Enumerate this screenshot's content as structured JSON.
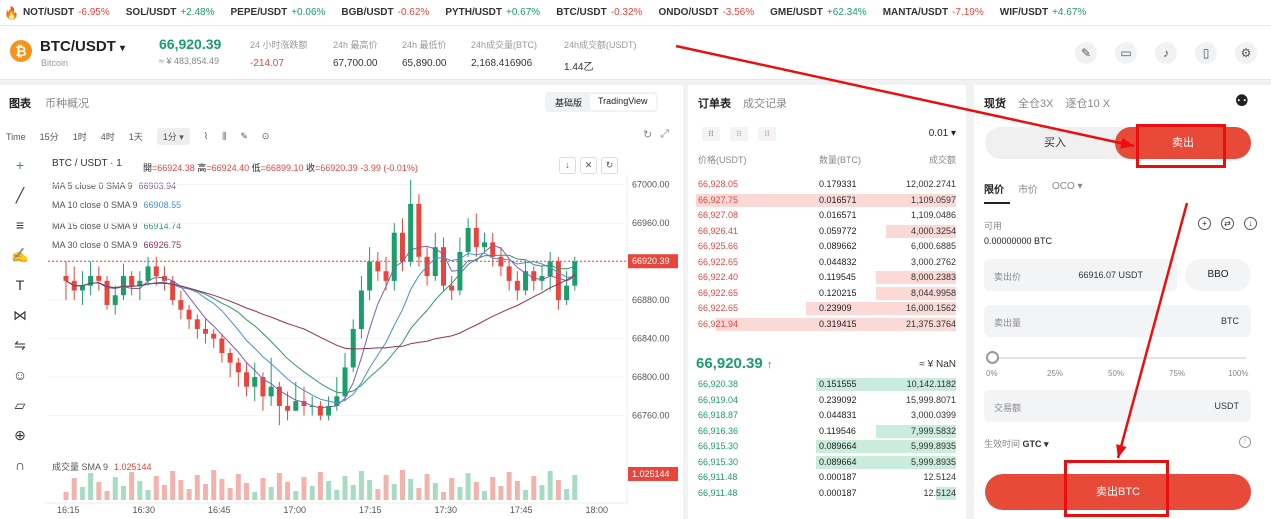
{
  "ticker": [
    {
      "sym": "NOT/USDT",
      "chg": "-6.95%",
      "dir": "dn"
    },
    {
      "sym": "SOL/USDT",
      "chg": "+2.48%",
      "dir": "up"
    },
    {
      "sym": "PEPE/USDT",
      "chg": "+0.06%",
      "dir": "up"
    },
    {
      "sym": "BGB/USDT",
      "chg": "-0.62%",
      "dir": "dn"
    },
    {
      "sym": "PYTH/USDT",
      "chg": "+0.67%",
      "dir": "up"
    },
    {
      "sym": "BTC/USDT",
      "chg": "-0.32%",
      "dir": "dn"
    },
    {
      "sym": "ONDO/USDT",
      "chg": "-3.56%",
      "dir": "dn"
    },
    {
      "sym": "GME/USDT",
      "chg": "+62.34%",
      "dir": "up"
    },
    {
      "sym": "MANTA/USDT",
      "chg": "-7.19%",
      "dir": "dn"
    },
    {
      "sym": "WIF/USDT",
      "chg": "+4.67%",
      "dir": "up"
    }
  ],
  "header": {
    "pair": "BTC/USDT",
    "caret": "▾",
    "sub": "Bitcoin",
    "logo": "₿",
    "price": "66,920.39",
    "price_cny": "≈ ¥ 483,854.49",
    "stats": [
      {
        "label": "24 小时涨跌额",
        "value": "-214.07",
        "color": "#e8453c"
      },
      {
        "label": "24h 最高价",
        "value": "67,700.00",
        "color": "#333"
      },
      {
        "label": "24h 最低价",
        "value": "65,890.00",
        "color": "#333"
      },
      {
        "label": "24h成交量(BTC)",
        "value": "2,168.416906",
        "color": "#333"
      },
      {
        "label": "24h成交额(USDT)",
        "value": "1.44乙",
        "color": "#333"
      }
    ],
    "icons": [
      "note-icon",
      "ticket-icon",
      "bell-icon",
      "book-icon",
      "settings-icon"
    ]
  },
  "chart_panel": {
    "tab_chart": "图表",
    "tab_overview": "币种概况",
    "view_basic": "基础版",
    "view_tv": "TradingView",
    "intervals": [
      "Time",
      "15分",
      "1时",
      "4时",
      "1天"
    ],
    "interval_selected": "1分 ▾",
    "caption": "BTC / USDT · 1",
    "ohlc": {
      "open_label": "開",
      "open": "=66924.38",
      "high_label": "高",
      "high": "=66924.40",
      "low_label": "低",
      "low": "=66899.10",
      "close_label": "收",
      "close": "=66920.39",
      "change": "-3.99 (-0.01%)"
    },
    "ma": [
      {
        "label": "MA 5 close 0 SMA 9",
        "value": "66903.94",
        "color": "#7b5fb1"
      },
      {
        "label": "MA 10 close 0 SMA 9",
        "value": "66908.55",
        "color": "#4a8fd8"
      },
      {
        "label": "MA 15 close 0 SMA 9",
        "value": "66914.74",
        "color": "#2e9a6a"
      },
      {
        "label": "MA 30 close 0 SMA 9",
        "value": "66926.75",
        "color": "#9b2d5a"
      }
    ],
    "volume_label": "成交量 SMA 9",
    "volume_value": "1.025144",
    "volume_tag": "1.025144",
    "last_price_tag": "66920.39"
  },
  "chart_data": {
    "type": "candlestick",
    "y_ticks": [
      67000,
      66960,
      66920,
      66880,
      66840,
      66800,
      66760
    ],
    "x_ticks": [
      "16:15",
      "16:30",
      "16:45",
      "17:00",
      "17:15",
      "17:30",
      "17:45",
      "18:00"
    ],
    "candles": [
      [
        66905,
        66900,
        66920,
        66880
      ],
      [
        66900,
        66890,
        66915,
        66880
      ],
      [
        66890,
        66895,
        66910,
        66875
      ],
      [
        66895,
        66905,
        66920,
        66885
      ],
      [
        66905,
        66900,
        66915,
        66890
      ],
      [
        66900,
        66875,
        66905,
        66870
      ],
      [
        66875,
        66885,
        66895,
        66865
      ],
      [
        66885,
        66905,
        66918,
        66880
      ],
      [
        66905,
        66895,
        66910,
        66885
      ],
      [
        66895,
        66900,
        66910,
        66880
      ],
      [
        66900,
        66915,
        66925,
        66895
      ],
      [
        66915,
        66905,
        66925,
        66895
      ],
      [
        66905,
        66900,
        66915,
        66890
      ],
      [
        66900,
        66880,
        66905,
        66875
      ],
      [
        66880,
        66870,
        66890,
        66860
      ],
      [
        66870,
        66860,
        66875,
        66850
      ],
      [
        66860,
        66850,
        66865,
        66840
      ],
      [
        66850,
        66845,
        66860,
        66835
      ],
      [
        66845,
        66840,
        66850,
        66830
      ],
      [
        66840,
        66825,
        66845,
        66815
      ],
      [
        66825,
        66815,
        66830,
        66800
      ],
      [
        66815,
        66805,
        66820,
        66790
      ],
      [
        66805,
        66790,
        66815,
        66780
      ],
      [
        66790,
        66800,
        66815,
        66775
      ],
      [
        66800,
        66780,
        66805,
        66765
      ],
      [
        66780,
        66790,
        66820,
        66770
      ],
      [
        66790,
        66770,
        66795,
        66750
      ],
      [
        66770,
        66765,
        66785,
        66755
      ],
      [
        66765,
        66775,
        66795,
        66765
      ],
      [
        66775,
        66770,
        66790,
        66760
      ],
      [
        66770,
        66770,
        66780,
        66760
      ],
      [
        66770,
        66760,
        66775,
        66755
      ],
      [
        66760,
        66770,
        66780,
        66755
      ],
      [
        66770,
        66780,
        66800,
        66765
      ],
      [
        66780,
        66810,
        66825,
        66775
      ],
      [
        66810,
        66850,
        66860,
        66805
      ],
      [
        66850,
        66890,
        66905,
        66840
      ],
      [
        66890,
        66920,
        66935,
        66880
      ],
      [
        66920,
        66910,
        66930,
        66900
      ],
      [
        66910,
        66900,
        66925,
        66890
      ],
      [
        66900,
        66950,
        66960,
        66890
      ],
      [
        66950,
        66920,
        66965,
        66910
      ],
      [
        66920,
        66980,
        67005,
        66915
      ],
      [
        66980,
        66925,
        66990,
        66915
      ],
      [
        66925,
        66905,
        66935,
        66895
      ],
      [
        66905,
        66935,
        66950,
        66900
      ],
      [
        66935,
        66895,
        66945,
        66890
      ],
      [
        66895,
        66890,
        66905,
        66880
      ],
      [
        66890,
        66930,
        66945,
        66885
      ],
      [
        66930,
        66955,
        66965,
        66925
      ],
      [
        66955,
        66935,
        66970,
        66925
      ],
      [
        66935,
        66940,
        66950,
        66930
      ],
      [
        66940,
        66925,
        66950,
        66915
      ],
      [
        66925,
        66915,
        66935,
        66905
      ],
      [
        66915,
        66900,
        66920,
        66890
      ],
      [
        66900,
        66890,
        66910,
        66880
      ],
      [
        66890,
        66910,
        66920,
        66885
      ],
      [
        66910,
        66900,
        66915,
        66890
      ],
      [
        66900,
        66905,
        66915,
        66890
      ],
      [
        66905,
        66920,
        66930,
        66890
      ],
      [
        66920,
        66880,
        66925,
        66870
      ],
      [
        66880,
        66895,
        66910,
        66875
      ],
      [
        66895,
        66920,
        66925,
        66890
      ]
    ],
    "ylim": [
      66745,
      67010
    ],
    "volume_max": 4
  },
  "orderbook": {
    "tab_book": "订单表",
    "tab_trades": "成交记录",
    "precision": "0.01 ▾",
    "headers": [
      "价格(USDT)",
      "数量(BTC)",
      "成交额"
    ],
    "asks": [
      {
        "p": "66,928.05",
        "a": "0.179331",
        "t": "12,002.2741",
        "w": 0
      },
      {
        "p": "66,927.75",
        "a": "0.016571",
        "t": "1,109.0597",
        "w": 260
      },
      {
        "p": "66,927.08",
        "a": "0.016571",
        "t": "1,109.0486",
        "w": 0
      },
      {
        "p": "66,926.41",
        "a": "0.059772",
        "t": "4,000.3254",
        "w": 70
      },
      {
        "p": "66,925.66",
        "a": "0.089662",
        "t": "6,000.6885",
        "w": 0
      },
      {
        "p": "66,922.65",
        "a": "0.044832",
        "t": "3,000.2762",
        "w": 0
      },
      {
        "p": "66,922.40",
        "a": "0.119545",
        "t": "8,000.2383",
        "w": 80
      },
      {
        "p": "66,922.65",
        "a": "0.120215",
        "t": "8,044.9958",
        "w": 80
      },
      {
        "p": "66,922.65",
        "a": "0.23909",
        "t": "16,000.1562",
        "w": 150
      },
      {
        "p": "66,921.94",
        "a": "0.319415",
        "t": "21,375.3764",
        "w": 240
      }
    ],
    "mid_price": "66,920.39",
    "mid_arrow": "↑",
    "mid_right": "≈ ¥ NaN",
    "bids": [
      {
        "p": "66,920.38",
        "a": "0.151555",
        "t": "10,142.1182",
        "w": 140
      },
      {
        "p": "66,919.04",
        "a": "0.239092",
        "t": "15,999.8071",
        "w": 0
      },
      {
        "p": "66,918.87",
        "a": "0.044831",
        "t": "3,000.0399",
        "w": 0
      },
      {
        "p": "66,916.36",
        "a": "0.119546",
        "t": "7,999.5832",
        "w": 80
      },
      {
        "p": "66,915.30",
        "a": "0.089664",
        "t": "5,999.8935",
        "w": 140
      },
      {
        "p": "66,915.30",
        "a": "0.089664",
        "t": "5,999.8935",
        "w": 140
      },
      {
        "p": "66,911.48",
        "a": "0.000187",
        "t": "12.5124",
        "w": 0
      },
      {
        "p": "66,911.48",
        "a": "0.000187",
        "t": "12.5124",
        "w": 20
      }
    ]
  },
  "trade": {
    "tab_spot": "现货",
    "tab_cross": "全仓3X",
    "tab_isolated": "逐仓10 X",
    "buy": "买入",
    "sell": "卖出",
    "order_types": [
      "限价",
      "市价",
      "OCO ▾"
    ],
    "available_label": "可用",
    "available_value": "0.00000000 BTC",
    "sell_price_label": "卖出价",
    "sell_price_value": "66916.07 USDT",
    "bbo": "BBO",
    "sell_amount_label": "卖出量",
    "sell_amount_unit": "BTC",
    "slider_labels": [
      "0%",
      "25%",
      "50%",
      "75%",
      "100%"
    ],
    "total_label": "交易额",
    "total_unit": "USDT",
    "tif_label": "生效时间",
    "tif_value": "GTC ▾",
    "submit": "卖出BTC"
  },
  "colors": {
    "up": "#1a9e6a",
    "down": "#e8453c",
    "annotation": "#ea0f0f"
  }
}
